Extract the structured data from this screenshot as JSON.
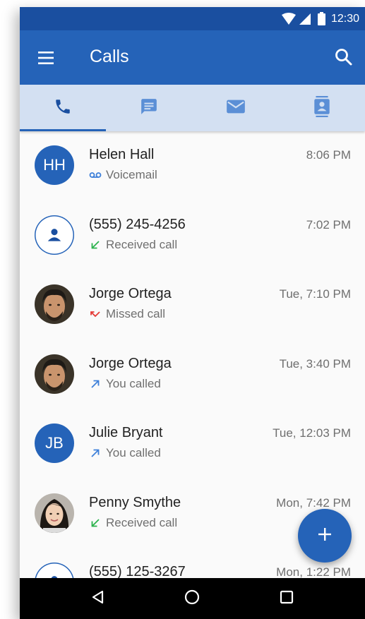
{
  "status_bar": {
    "time": "12:30",
    "icons": [
      "wifi-icon",
      "cellular-signal-icon",
      "battery-icon"
    ]
  },
  "app_bar": {
    "title": "Calls",
    "menu_icon": "menu-icon",
    "search_icon": "search-icon",
    "color": "#2563b8"
  },
  "tabs": [
    {
      "icon": "phone-icon",
      "active": true
    },
    {
      "icon": "message-icon",
      "active": false
    },
    {
      "icon": "mail-icon",
      "active": false
    },
    {
      "icon": "contacts-icon",
      "active": false
    }
  ],
  "calls": [
    {
      "name": "Helen Hall",
      "type": "Voicemail",
      "type_icon": "voicemail-icon",
      "time": "8:06 PM",
      "avatar": {
        "kind": "initials",
        "text": "HH"
      }
    },
    {
      "name": "(555) 245-4256",
      "type": "Received call",
      "type_icon": "received-call-icon",
      "time": "7:02 PM",
      "avatar": {
        "kind": "unknown-person"
      }
    },
    {
      "name": "Jorge Ortega",
      "type": "Missed call",
      "type_icon": "missed-call-icon",
      "time": "Tue, 7:10 PM",
      "avatar": {
        "kind": "photo"
      }
    },
    {
      "name": "Jorge Ortega",
      "type": "You called",
      "type_icon": "outgoing-call-icon",
      "time": "Tue, 3:40 PM",
      "avatar": {
        "kind": "photo"
      }
    },
    {
      "name": "Julie Bryant",
      "type": "You called",
      "type_icon": "outgoing-call-icon",
      "time": "Tue, 12:03 PM",
      "avatar": {
        "kind": "initials",
        "text": "JB"
      }
    },
    {
      "name": "Penny Smythe",
      "type": "Received call",
      "type_icon": "received-call-icon",
      "time": "Mon, 7:42 PM",
      "avatar": {
        "kind": "photo"
      }
    },
    {
      "name": "(555) 125-3267",
      "type": "",
      "type_icon": "",
      "time": "Mon, 1:22 PM",
      "avatar": {
        "kind": "unknown-person"
      }
    }
  ],
  "fab": {
    "icon": "add-icon"
  },
  "nav_bar": {
    "icons": [
      "back-icon",
      "home-icon",
      "recents-icon"
    ]
  },
  "colors": {
    "status_bar": "#1a4fa0",
    "primary": "#2563b8",
    "tab_bar": "#d3e0f2",
    "received": "#2bb24c",
    "missed": "#e53935",
    "outgoing": "#3d7fd9"
  }
}
